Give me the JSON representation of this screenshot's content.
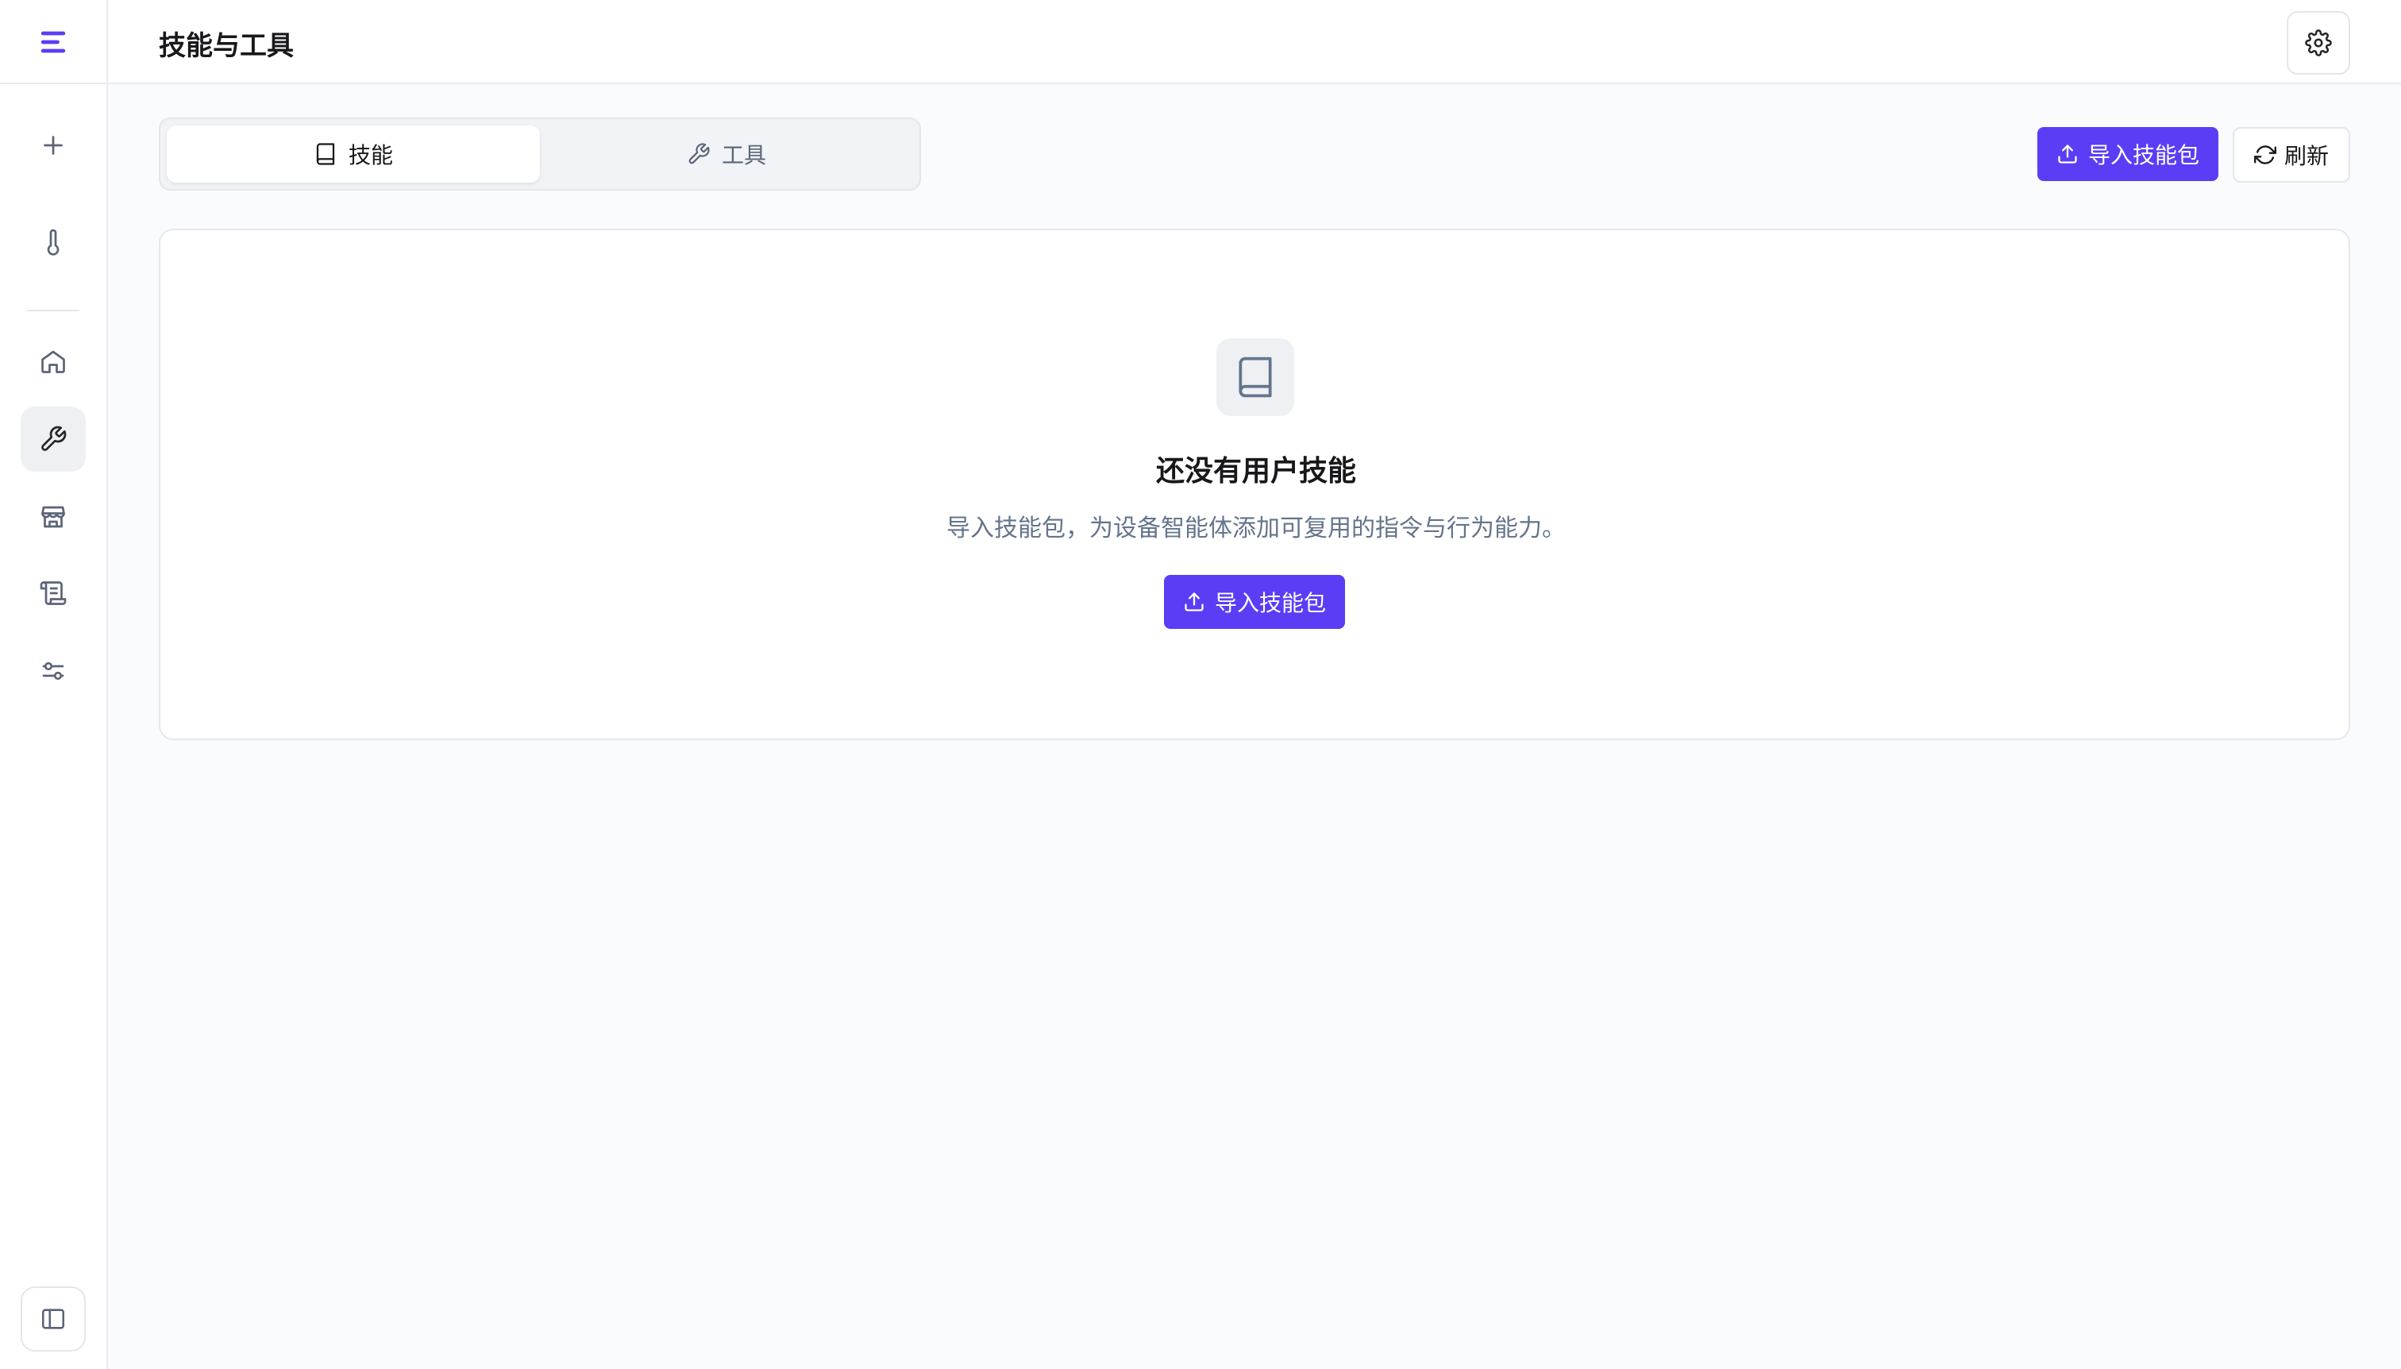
{
  "header": {
    "title": "技能与工具"
  },
  "sidebar": {
    "logo": "menu-logo-icon",
    "items": [
      {
        "icon": "plus-icon",
        "active": false
      },
      {
        "icon": "thermometer-icon",
        "active": false
      },
      {
        "icon": "home-icon",
        "active": false
      },
      {
        "icon": "wrench-icon",
        "active": true
      },
      {
        "icon": "store-icon",
        "active": false
      },
      {
        "icon": "scroll-icon",
        "active": false
      },
      {
        "icon": "sliders-icon",
        "active": false
      }
    ],
    "collapse_icon": "panel-left-icon"
  },
  "tabs": [
    {
      "label": "技能",
      "icon": "book-icon",
      "active": true
    },
    {
      "label": "工具",
      "icon": "wrench-icon",
      "active": false
    }
  ],
  "toolbar": {
    "import_label": "导入技能包",
    "refresh_label": "刷新"
  },
  "empty_state": {
    "icon": "book-icon",
    "title": "还没有用户技能",
    "description": "导入技能包，为设备智能体添加可复用的指令与行为能力。",
    "button_label": "导入技能包"
  },
  "colors": {
    "accent": "#5b3df5",
    "background": "#fafbfd",
    "border": "#e4e6eb",
    "muted_text": "#64748b"
  }
}
